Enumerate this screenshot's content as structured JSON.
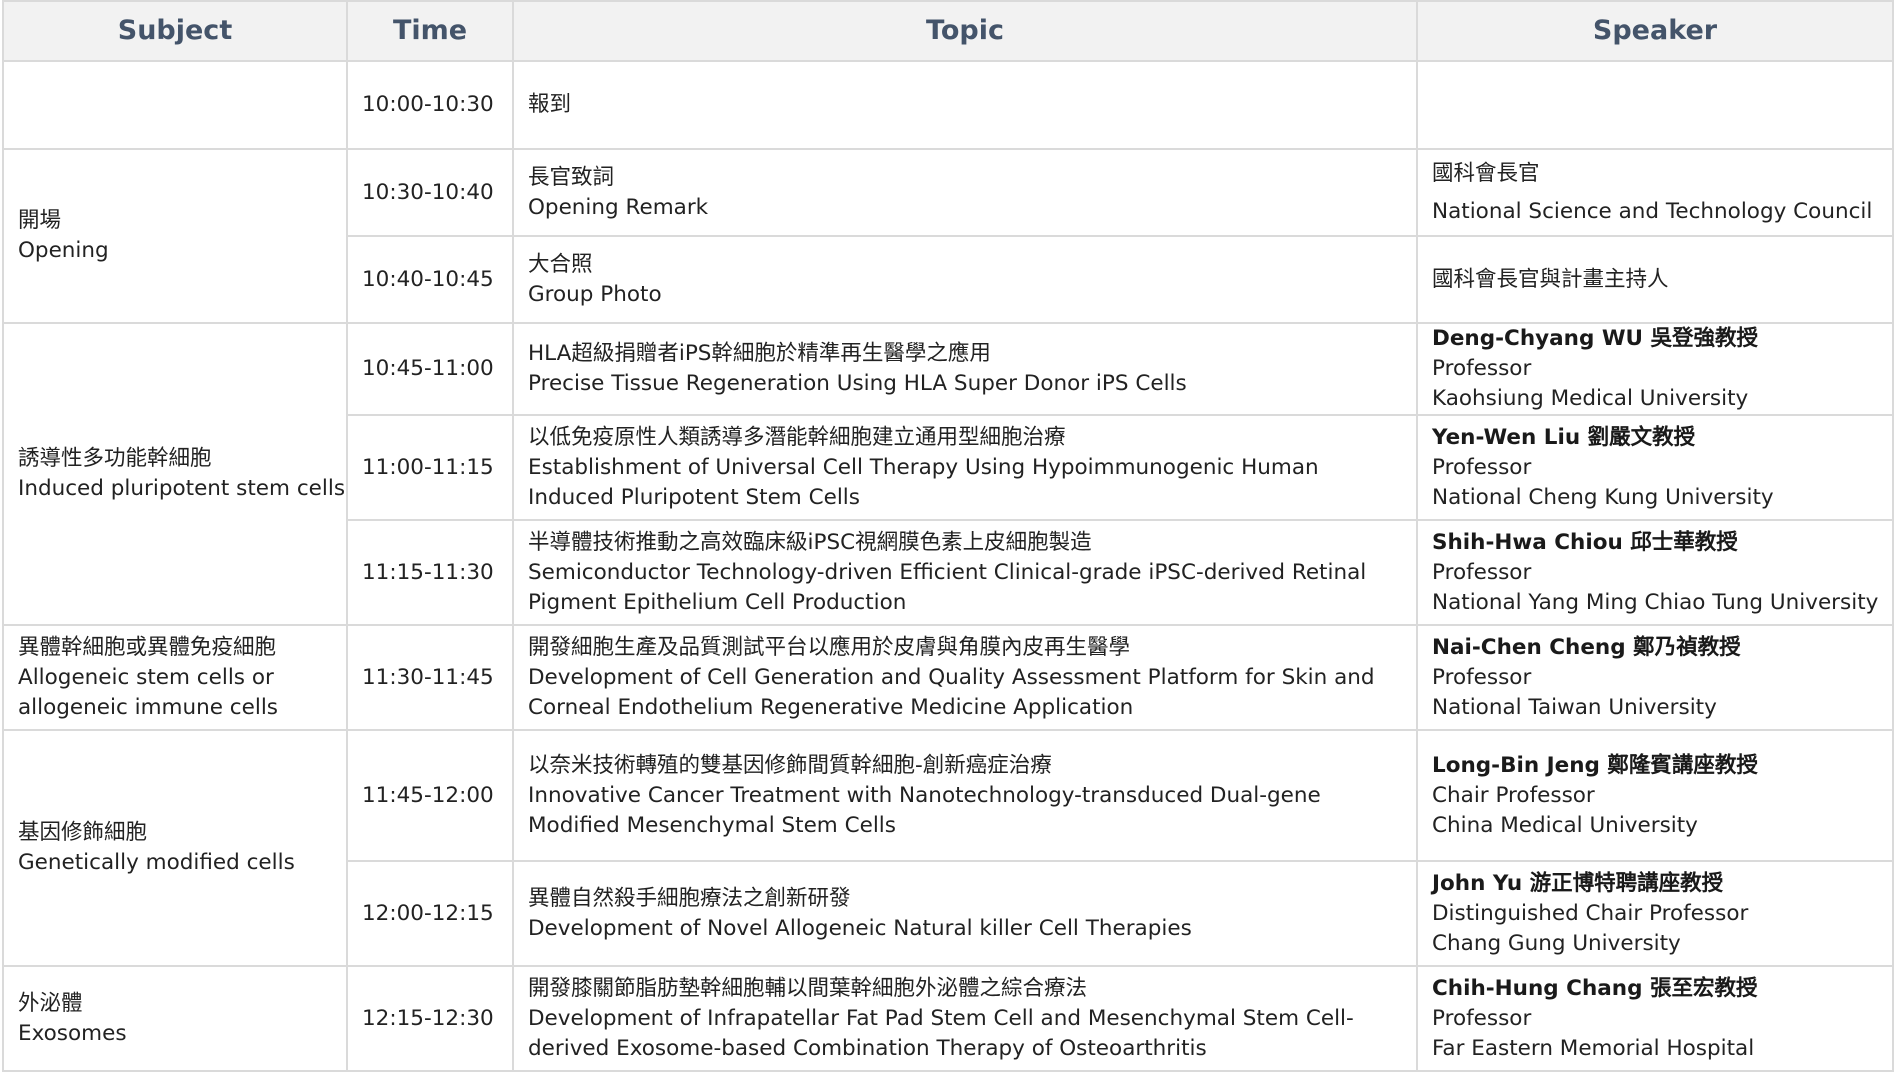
{
  "headers": {
    "subject": "Subject",
    "time": "Time",
    "topic": "Topic",
    "speaker": "Speaker"
  },
  "subjects": [
    {
      "zh": "",
      "en": ""
    },
    {
      "zh": "開場",
      "en": "Opening"
    },
    {
      "zh": "誘導性多功能幹細胞",
      "en": "Induced pluripotent stem cells"
    },
    {
      "zh": "異體幹細胞或異體免疫細胞",
      "en": "Allogeneic stem cells or allogeneic immune cells"
    },
    {
      "zh": "基因修飾細胞",
      "en": "Genetically modified cells"
    },
    {
      "zh": "外泌體",
      "en": "Exosomes"
    }
  ],
  "rows": [
    {
      "time": "10:00-10:30",
      "topic_zh": "報到",
      "topic_en": "",
      "speaker_name": "",
      "speaker_title": "",
      "speaker_org": ""
    },
    {
      "time": "10:30-10:40",
      "topic_zh": "長官致詞",
      "topic_en": "Opening Remark",
      "speaker_name": "國科會長官",
      "speaker_title": "",
      "speaker_org": "National Science and Technology Council"
    },
    {
      "time": "10:40-10:45",
      "topic_zh": "大合照",
      "topic_en": "Group Photo",
      "speaker_name": "國科會長官與計畫主持人",
      "speaker_title": "",
      "speaker_org": ""
    },
    {
      "time": "10:45-11:00",
      "topic_zh": "HLA超級捐贈者iPS幹細胞於精準再生醫學之應用",
      "topic_en": "Precise Tissue Regeneration Using HLA Super Donor iPS Cells",
      "speaker_name": "Deng-Chyang WU 吳登強教授",
      "speaker_title": "Professor",
      "speaker_org": "Kaohsiung Medical University"
    },
    {
      "time": "11:00-11:15",
      "topic_zh": "以低免疫原性人類誘導多潛能幹細胞建立通用型細胞治療",
      "topic_en": "Establishment of Universal Cell Therapy Using Hypoimmunogenic Human Induced Pluripotent Stem Cells",
      "speaker_name": "Yen-Wen Liu 劉嚴文教授",
      "speaker_title": "Professor",
      "speaker_org": "National Cheng Kung University"
    },
    {
      "time": "11:15-11:30",
      "topic_zh": "半導體技術推動之高效臨床級iPSC視網膜色素上皮細胞製造",
      "topic_en": "Semiconductor Technology-driven Efficient Clinical-grade iPSC-derived Retinal Pigment Epithelium Cell Production",
      "speaker_name": "Shih-Hwa Chiou 邱士華教授",
      "speaker_title": "Professor",
      "speaker_org": "National Yang Ming Chiao Tung University"
    },
    {
      "time": "11:30-11:45",
      "topic_zh": "開發細胞生產及品質測試平台以應用於皮膚與角膜內皮再生醫學",
      "topic_en": "Development of Cell Generation and Quality Assessment Platform for Skin and Corneal Endothelium Regenerative Medicine Application",
      "speaker_name": "Nai-Chen Cheng 鄭乃禎教授",
      "speaker_title": "Professor",
      "speaker_org": "National Taiwan University"
    },
    {
      "time": "11:45-12:00",
      "topic_zh": "以奈米技術轉殖的雙基因修飾間質幹細胞-創新癌症治療",
      "topic_en": "Innovative Cancer Treatment with Nanotechnology-transduced Dual-gene Modified Mesenchymal Stem Cells",
      "speaker_name": "Long-Bin Jeng 鄭隆賓講座教授",
      "speaker_title": "Chair Professor",
      "speaker_org": "China Medical University"
    },
    {
      "time": "12:00-12:15",
      "topic_zh": "異體自然殺手細胞療法之創新研發",
      "topic_en": "Development of Novel Allogeneic Natural killer Cell Therapies",
      "speaker_name": "John Yu 游正博特聘講座教授",
      "speaker_title": "Distinguished Chair Professor",
      "speaker_org": "Chang Gung University"
    },
    {
      "time": "12:15-12:30",
      "topic_zh": "開發膝關節脂肪墊幹細胞輔以間葉幹細胞外泌體之綜合療法",
      "topic_en": "Development of Infrapatellar Fat Pad Stem Cell and Mesenchymal Stem Cell-derived Exosome-based Combination Therapy of Osteoarthritis",
      "speaker_name": "Chih-Hung Chang 張至宏教授",
      "speaker_title": "Professor",
      "speaker_org": "Far Eastern Memorial Hospital"
    }
  ]
}
